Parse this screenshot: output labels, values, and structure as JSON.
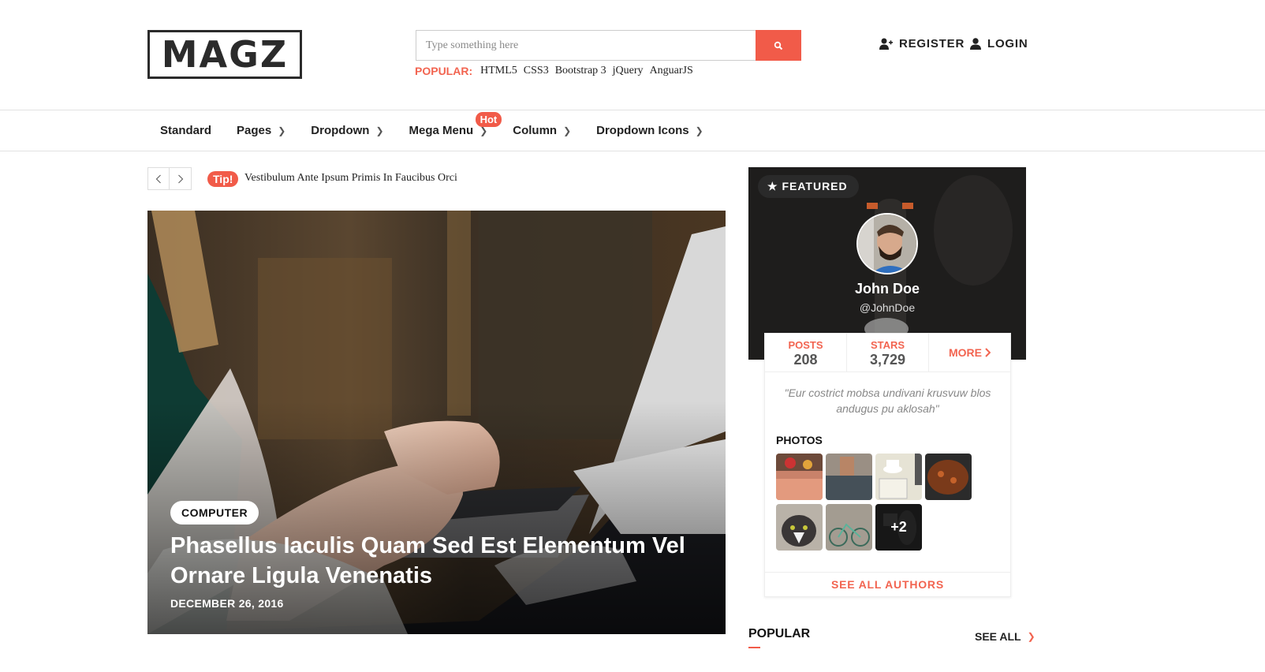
{
  "header": {
    "logo": "MAGZ",
    "search": {
      "placeholder": "Type something here",
      "value": "",
      "button_icon": "search-icon"
    },
    "popular_label": "POPULAR:",
    "popular_tags": [
      "HTML5",
      "CSS3",
      "Bootstrap 3",
      "jQuery",
      "AnguarJS"
    ],
    "register_label": "REGISTER",
    "login_label": "LOGIN"
  },
  "nav": {
    "items": [
      {
        "label": "Standard",
        "has_dropdown": false
      },
      {
        "label": "Pages",
        "has_dropdown": true
      },
      {
        "label": "Dropdown",
        "has_dropdown": true
      },
      {
        "label": "Mega Menu",
        "has_dropdown": true,
        "badge": "Hot"
      },
      {
        "label": "Column",
        "has_dropdown": true
      },
      {
        "label": "Dropdown Icons",
        "has_dropdown": true
      }
    ]
  },
  "ticker": {
    "prev_icon": "chevron-left-icon",
    "next_icon": "chevron-right-icon",
    "badge": "Tip!",
    "text": "Vestibulum Ante Ipsum Primis In Faucibus Orci"
  },
  "hero": {
    "category": "COMPUTER",
    "title": "Phasellus Iaculis Quam Sed Est Elementum Vel Ornare Ligula Venenatis",
    "date": "DECEMBER 26, 2016"
  },
  "featured": {
    "badge": "★ FEATURED",
    "name": "John Doe",
    "handle": "@JohnDoe",
    "stats": [
      {
        "label": "POSTS",
        "value": "208"
      },
      {
        "label": "STARS",
        "value": "3,729"
      }
    ],
    "more_label": "MORE",
    "quote": "\"Eur costrict mobsa undivani krusvuw blos andugus pu aklosah\"",
    "photos_title": "PHOTOS",
    "photos": [
      "food",
      "bridge",
      "coffee",
      "pan",
      "cat",
      "bicycle",
      "more"
    ],
    "photos_more": "+2",
    "see_all_authors": "SEE ALL AUTHORS"
  },
  "popular_section": {
    "title": "POPULAR",
    "see_all": "SEE ALL"
  },
  "colors": {
    "accent": "#f15b49",
    "text": "#222222",
    "border": "#e2e2e2"
  }
}
